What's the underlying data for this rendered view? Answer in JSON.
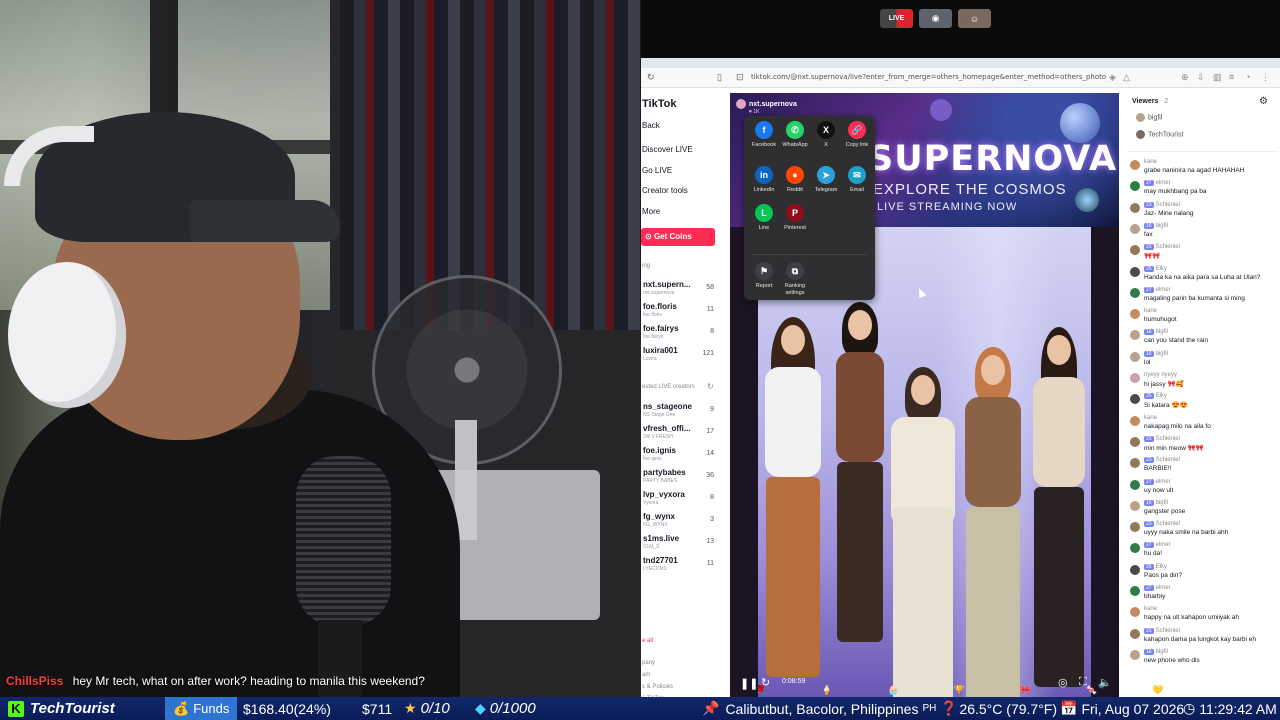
{
  "top_icons": {
    "live_label": "LIVE"
  },
  "browser": {
    "url": "tiktok.com/@nxt.supernova/live?enter_from_merge=others_homepage&enter_method=others_photo"
  },
  "nav": {
    "logo": "TikTok",
    "back": "Back",
    "discover": "Discover LIVE",
    "go_live": "Go LIVE",
    "creator_tools": "Creator tools",
    "more": "More",
    "get_coins": "Get Coins",
    "following_section": "ing",
    "following": [
      {
        "name": "nxt.supern...",
        "sub": "nxt.supernova",
        "count": "58"
      },
      {
        "name": "foe.floris",
        "sub": "foe.floris",
        "count": "11"
      },
      {
        "name": "foe.fairys",
        "sub": "foe.fairys",
        "count": "8"
      },
      {
        "name": "luxira001",
        "sub": "Luxira",
        "count": "121"
      }
    ],
    "suggested_section": "ested LIVE creators",
    "suggested": [
      {
        "name": "ns_stageone",
        "sub": "NS Stage One",
        "count": "9"
      },
      {
        "name": "vfresh_offi...",
        "sub": "JW V.FRESH",
        "count": "17"
      },
      {
        "name": "foe.ignis",
        "sub": "foe.ignis",
        "count": "14"
      },
      {
        "name": "partybabes",
        "sub": "PARTY BABES",
        "count": "36"
      },
      {
        "name": "lvp_vyxora",
        "sub": "Vyxora",
        "count": "8"
      },
      {
        "name": "fg_wynx",
        "sub": "FG_WYNX",
        "count": "3"
      },
      {
        "name": "s1ms.live",
        "sub": "S1M_S",
        "count": "13"
      },
      {
        "name": "tnd27701",
        "sub": "LYECONS",
        "count": "11"
      }
    ],
    "see_all": "e all",
    "footer": [
      "pany",
      "am",
      "s & Policies",
      "6 TikTok"
    ]
  },
  "player": {
    "host_name": "nxt.supernova",
    "host_sub": "♥ 1K",
    "banner_title": "SUPERNOVA",
    "banner_sub1": "EXPLORE THE COSMOS",
    "banner_sub2": "LIVE STREAMING NOW",
    "time": "0:08:59"
  },
  "share": {
    "options": [
      {
        "label": "Facebook",
        "glyph": "f",
        "color": "#1877f2"
      },
      {
        "label": "WhatsApp",
        "glyph": "✆",
        "color": "#25d366"
      },
      {
        "label": "X",
        "glyph": "X",
        "color": "#111111"
      },
      {
        "label": "Copy link",
        "glyph": "🔗",
        "color": "#fe2c55"
      },
      {
        "label": "LinkedIn",
        "glyph": "in",
        "color": "#0a66c2"
      },
      {
        "label": "Reddit",
        "glyph": "●",
        "color": "#ff4500"
      },
      {
        "label": "Telegram",
        "glyph": "➤",
        "color": "#2aa1da"
      },
      {
        "label": "Email",
        "glyph": "✉",
        "color": "#1da1c8"
      },
      {
        "label": "Line",
        "glyph": "L",
        "color": "#06c755"
      },
      {
        "label": "Pinterest",
        "glyph": "P",
        "color": "#8f0f1a"
      },
      {
        "label": "Report",
        "glyph": "⚑",
        "color": "#3f3f43"
      },
      {
        "label": "Ranking settings",
        "glyph": "⧉",
        "color": "#3f3f43"
      }
    ]
  },
  "viewers": {
    "title": "Viewers",
    "count": "2",
    "list": [
      "bigfil",
      "TechTourist"
    ]
  },
  "chat": [
    {
      "user": "kane",
      "lvl": "",
      "text": "grabe naninira na agad HAHAHAH",
      "color": "#c58a5e"
    },
    {
      "user": "elmer",
      "lvl": "27",
      "text": "may mukhbang pa ba",
      "color": "#2e7d46"
    },
    {
      "user": "Schieniel",
      "lvl": "23",
      "text": "Jaz- Mine nalang",
      "color": "#8c7a5a"
    },
    {
      "user": "bigfil",
      "lvl": "16",
      "text": "fax",
      "color": "#b8a28c"
    },
    {
      "user": "Schieniel",
      "lvl": "23",
      "text": "🎀🎀",
      "color": "#8c7a5a"
    },
    {
      "user": "Elky",
      "lvl": "25",
      "text": "Handa ka na aika para sa Luha at Ulan?",
      "color": "#4a4a4a"
    },
    {
      "user": "elmer",
      "lvl": "27",
      "text": "magaling parin ba kumanta si ming",
      "color": "#2e7d46"
    },
    {
      "user": "kane",
      "lvl": "",
      "text": "humuhugot",
      "color": "#c58a5e"
    },
    {
      "user": "bigfil",
      "lvl": "16",
      "text": "can you stand the rain",
      "color": "#b8a28c"
    },
    {
      "user": "bigfil",
      "lvl": "16",
      "text": "lol",
      "color": "#b8a28c"
    },
    {
      "user": "nyeyy nyeyy",
      "lvl": "",
      "text": "hi jassy 🎀🥰",
      "color": "#c9a0b0"
    },
    {
      "user": "Elky",
      "lvl": "25",
      "text": "Si katara 😍😍",
      "color": "#4a4a4a"
    },
    {
      "user": "kane",
      "lvl": "",
      "text": "nakapag milo na aila fo",
      "color": "#c58a5e"
    },
    {
      "user": "Schieniel",
      "lvl": "23",
      "text": "min min meow 🎀🎀",
      "color": "#8c7a5a"
    },
    {
      "user": "Schieniel",
      "lvl": "23",
      "text": "BARBIE!!",
      "color": "#8c7a5a"
    },
    {
      "user": "elmer",
      "lvl": "27",
      "text": "uy now ult",
      "color": "#2e7d46"
    },
    {
      "user": "bigfil",
      "lvl": "16",
      "text": "gangster pose",
      "color": "#b8a28c"
    },
    {
      "user": "Schieniel",
      "lvl": "23",
      "text": "uyyy naka smile na barbi ahh",
      "color": "#8c7a5a"
    },
    {
      "user": "elmer",
      "lvl": "27",
      "text": "hu da!",
      "color": "#2e7d46"
    },
    {
      "user": "Elky",
      "lvl": "25",
      "text": "Paos pa din?",
      "color": "#4a4a4a"
    },
    {
      "user": "elmer",
      "lvl": "27",
      "text": "bharbiy",
      "color": "#2e7d46"
    },
    {
      "user": "kane",
      "lvl": "",
      "text": "happy na ult kahapon umiiyak ah",
      "color": "#c58a5e"
    },
    {
      "user": "Schieniel",
      "lvl": "23",
      "text": "kahapon dama pa lungkot kay barbi eh",
      "color": "#8c7a5a"
    },
    {
      "user": "bigfil",
      "lvl": "16",
      "text": "new phone who dis",
      "color": "#b8a28c"
    }
  ],
  "overlay_chat": {
    "user": "ChillsPiss",
    "text": "hey Mr tech, what on after work? heading to manila this weekend?"
  },
  "status_bar": {
    "channel": "TechTourist",
    "funds_label": "Funds",
    "funds_value": "$168.40(24%)",
    "money": "$711",
    "stars": "0/10",
    "gems": "0/1000",
    "location": "Calibutbut, Bacolor, Philippines",
    "country": "PH",
    "weather": "26.5°C (79.7°F)",
    "date": "Fri, Aug 07 2026",
    "time": "11:29:42 AM"
  },
  "colors": {
    "accent": "#fe2c55",
    "bar_bg": "#0a1c57",
    "kick_green": "#53fc18"
  }
}
